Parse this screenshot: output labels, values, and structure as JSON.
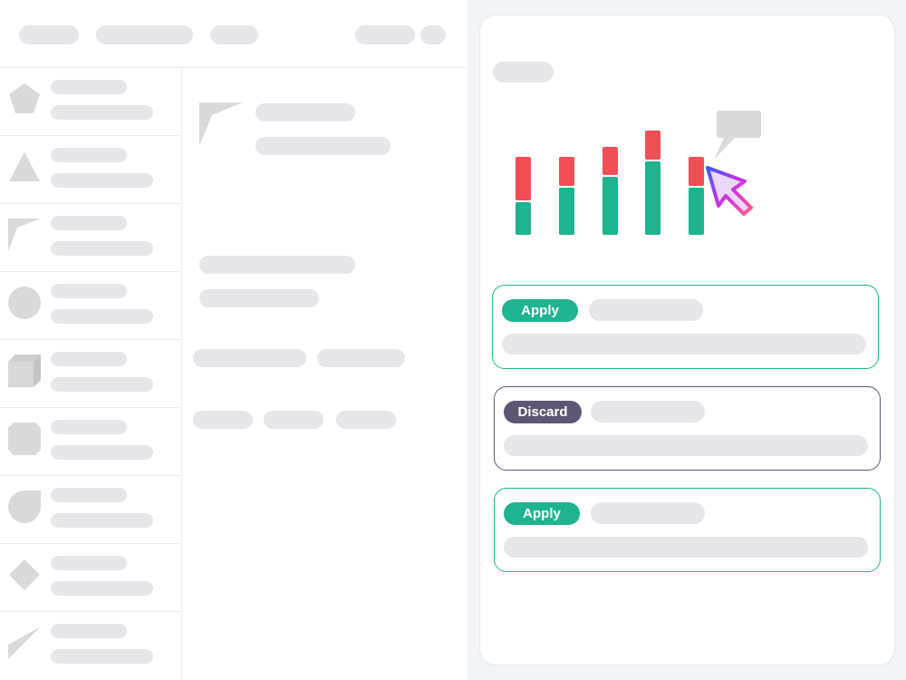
{
  "options": [
    {
      "label": "Apply",
      "kind": "apply"
    },
    {
      "label": "Discard",
      "kind": "discard"
    },
    {
      "label": "Apply",
      "kind": "apply"
    }
  ],
  "colors": {
    "apply": "#1db48f",
    "discard": "#5e5773",
    "bar_top": "#f24e56",
    "bar_bottom": "#1db48f",
    "placeholder": "#e6e6e9",
    "shape": "#d9d9d9"
  },
  "sidebar_icons": [
    "pentagon-icon",
    "triangle-icon",
    "corner-icon",
    "circle-icon",
    "cube-icon",
    "octagon-icon",
    "drop-icon",
    "diamond-icon",
    "wedge-icon"
  ],
  "illustration": {
    "bars": [
      {
        "bottom": 0.43,
        "top": 0.57
      },
      {
        "bottom": 0.62,
        "top": 0.38
      },
      {
        "bottom": 0.67,
        "top": 0.33
      },
      {
        "bottom": 0.72,
        "top": 0.28
      },
      {
        "bottom": 0.62,
        "top": 0.38
      }
    ],
    "icons": [
      "speech-bubble-icon",
      "cursor-arrow-icon"
    ]
  }
}
